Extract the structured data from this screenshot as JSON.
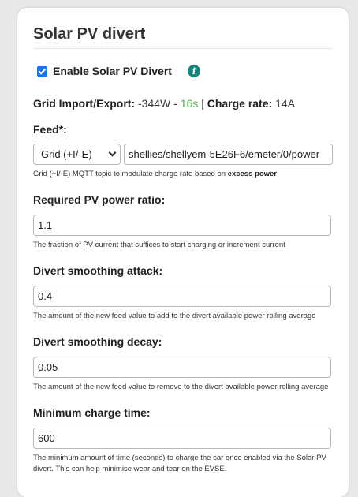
{
  "title": "Solar PV divert",
  "enable": {
    "label": "Enable Solar PV Divert",
    "checked": true,
    "info_icon": "i"
  },
  "status": {
    "grid_label": "Grid Import/Export:",
    "grid_value": "-344W",
    "separator": "-",
    "age": "16s",
    "pipe": "|",
    "charge_label": "Charge rate:",
    "charge_value": "14A",
    "age_color": "#4caf50"
  },
  "feed": {
    "label": "Feed*:",
    "select_value": "Grid (+I/-E)",
    "topic_value": "shellies/shellyem-5E26F6/emeter/0/power",
    "help_prefix": "Grid (+I/-E) MQTT topic to modulate charge rate based on",
    "help_bold": "excess power"
  },
  "pv_ratio": {
    "label": "Required PV power ratio:",
    "value": "1.1",
    "help": "The fraction of PV current that suffices to start charging or increment current"
  },
  "attack": {
    "label": "Divert smoothing attack:",
    "value": "0.4",
    "help": "The amount of the new feed value to add to the divert available power rolling average"
  },
  "decay": {
    "label": "Divert smoothing decay:",
    "value": "0.05",
    "help": "The amount of the new feed value to remove to the divert available power rolling average"
  },
  "min_time": {
    "label": "Minimum charge time:",
    "value": "600",
    "help": "The minimum amount of time (seconds) to charge the car once enabled via the Solar PV divert. This can help minimise wear and tear on the EVSE."
  }
}
